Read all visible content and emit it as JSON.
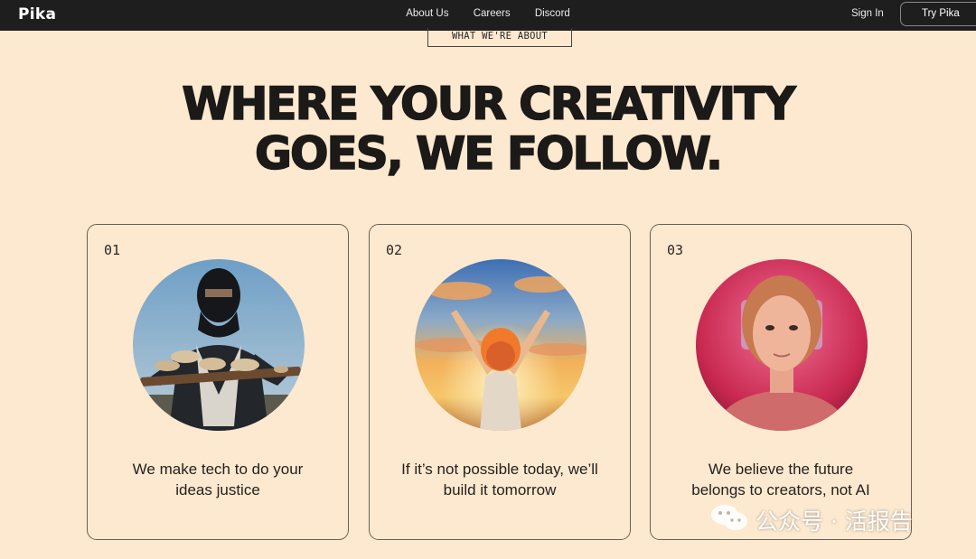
{
  "nav": {
    "logo": "Pika",
    "links": [
      "About Us",
      "Careers",
      "Discord"
    ],
    "sign_in": "Sign In",
    "try_button": "Try Pika"
  },
  "hero": {
    "tag": "WHAT WE'RE ABOUT",
    "headline_line1": "WHERE YOUR CREATIVITY",
    "headline_line2": "GOES, WE FOLLOW."
  },
  "cards": [
    {
      "number": "01",
      "line1": "We make tech to do your",
      "line2": "ideas justice",
      "image": "ninja-holding-tray-of-cookies"
    },
    {
      "number": "02",
      "line1": "If it’s not possible today, we’ll",
      "line2": "build it tomorrow",
      "image": "anime-character-arms-raised-at-sunset"
    },
    {
      "number": "03",
      "line1": "We believe the future",
      "line2": "belongs to creators, not AI",
      "image": "girl-portrait-pink-light"
    }
  ],
  "watermark": {
    "text": "公众号 · 活报告",
    "icon": "wechat-icon"
  },
  "colors": {
    "page_bg": "#fde9cf",
    "nav_bg": "#1e1e1e",
    "text": "#1b1a18"
  }
}
